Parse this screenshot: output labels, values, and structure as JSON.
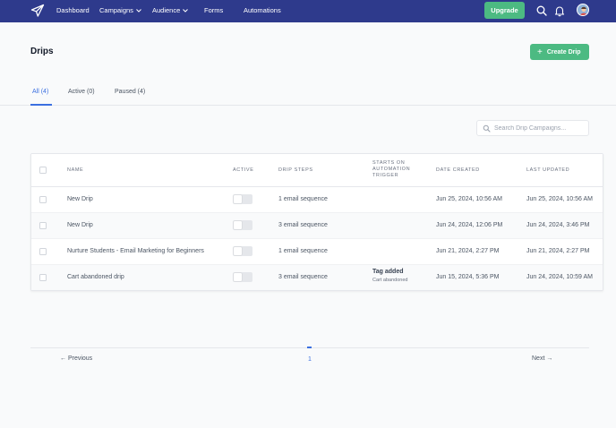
{
  "nav": {
    "items": [
      {
        "label": "Dashboard",
        "dropdown": false
      },
      {
        "label": "Campaigns",
        "dropdown": true
      },
      {
        "label": "Audience",
        "dropdown": true
      },
      {
        "label": "Forms",
        "dropdown": false
      },
      {
        "label": "Automations",
        "dropdown": false
      }
    ],
    "upgrade_label": "Upgrade",
    "icons": [
      "paper-plane-logo-icon",
      "search-icon",
      "bell-icon",
      "avatar"
    ],
    "colors": {
      "bar": "#2e3a8c",
      "accent": "#4cba82"
    }
  },
  "page": {
    "title": "Drips",
    "create_label": "Create Drip"
  },
  "tabs": [
    {
      "label": "All (4)",
      "active": true
    },
    {
      "label": "Active (0)",
      "active": false
    },
    {
      "label": "Paused (4)",
      "active": false
    }
  ],
  "search": {
    "placeholder": "Search Drip Campaigns...",
    "value": ""
  },
  "table": {
    "headers": {
      "name": "Name",
      "active": "Active",
      "steps": "Drip Steps",
      "trigger": [
        "Starts on",
        "automation",
        "trigger"
      ],
      "created": "Date Created",
      "updated": "Last Updated"
    },
    "rows": [
      {
        "name": "New Drip",
        "active": false,
        "steps": "1 email sequence",
        "trigger_title": "",
        "trigger_sub": "",
        "created": "Jun 25, 2024, 10:56 AM",
        "updated": "Jun 25, 2024, 10:56 AM"
      },
      {
        "name": "New Drip",
        "active": false,
        "steps": "3 email sequence",
        "trigger_title": "",
        "trigger_sub": "",
        "created": "Jun 24, 2024, 12:06 PM",
        "updated": "Jun 24, 2024, 3:46 PM"
      },
      {
        "name": "Nurture Students - Email Marketing for Beginners",
        "active": false,
        "steps": "1 email sequence",
        "trigger_title": "",
        "trigger_sub": "",
        "created": "Jun 21, 2024, 2:27 PM",
        "updated": "Jun 21, 2024, 2:27 PM"
      },
      {
        "name": "Cart abandoned drip",
        "active": false,
        "steps": "3 email sequence",
        "trigger_title": "Tag added",
        "trigger_sub": "Cart abandoned",
        "created": "Jun 15, 2024, 5:36 PM",
        "updated": "Jun 24, 2024, 10:59 AM"
      }
    ]
  },
  "pagination": {
    "prev_label": "← Previous",
    "next_label": "Next →",
    "current_page": "1"
  }
}
